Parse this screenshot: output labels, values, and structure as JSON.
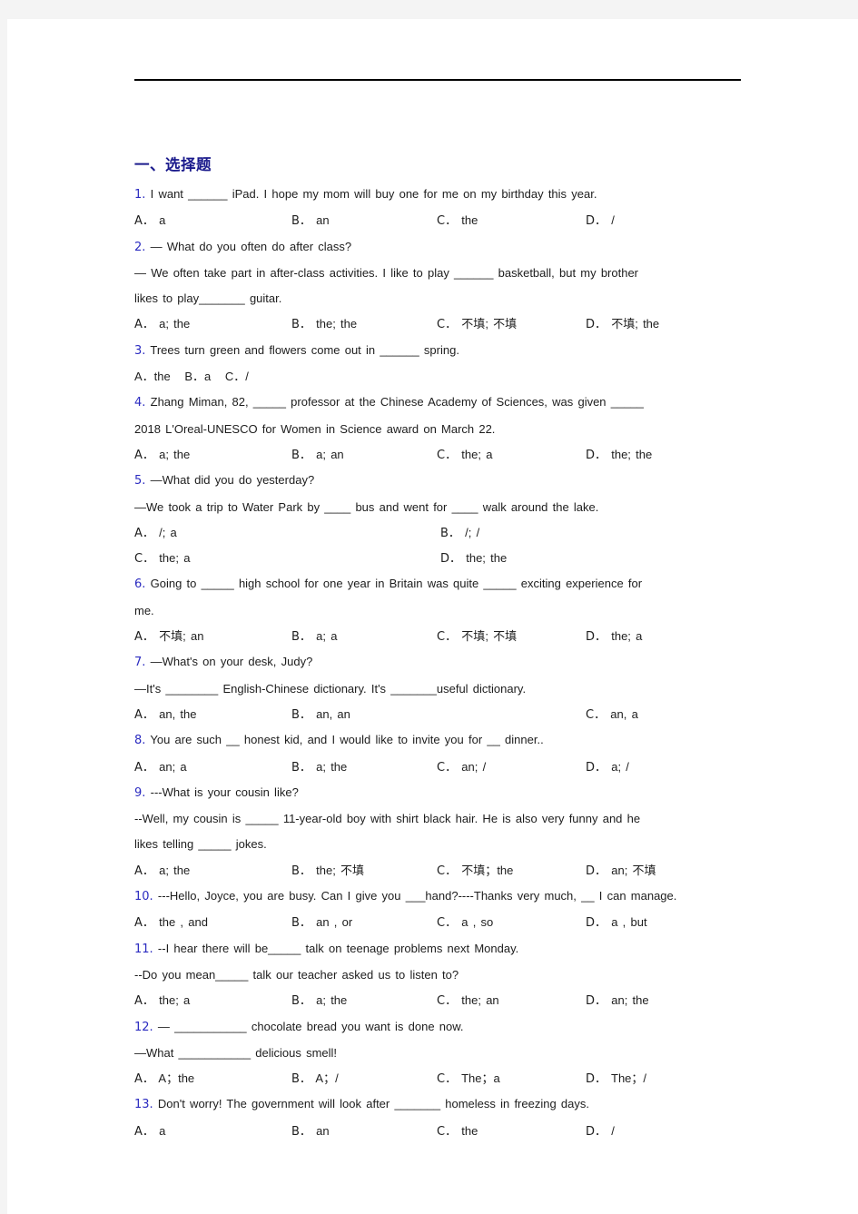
{
  "document": {
    "section_heading": "一、选择题",
    "questions": [
      {
        "number": "1.",
        "lines": [
          "I want ______ iPad. I hope my mom will buy one for me on my birthday this year."
        ],
        "option_layout": "four-col",
        "options": [
          {
            "letter": "A．",
            "text": "a"
          },
          {
            "letter": "B．",
            "text": "an"
          },
          {
            "letter": "C．",
            "text": "the"
          },
          {
            "letter": "D．",
            "text": "/"
          }
        ]
      },
      {
        "number": "2.",
        "lines": [
          "— What do you often do after class?",
          "— We often take part in after-class activities. I like to play ______ basketball, but my brother",
          "likes to play_______ guitar."
        ],
        "option_layout": "four-col",
        "options": [
          {
            "letter": "A．",
            "text": "a; the"
          },
          {
            "letter": "B．",
            "text": "the; the"
          },
          {
            "letter": "C．",
            "text": "不填; 不填"
          },
          {
            "letter": "D．",
            "text": "不填; the"
          }
        ]
      },
      {
        "number": "3.",
        "lines": [
          "Trees turn green and flowers come out in ______ spring."
        ],
        "option_layout": "inline",
        "options_inline": "A．the   B．a   C．/"
      },
      {
        "number": "4.",
        "lines": [
          "Zhang Miman, 82, _____ professor at the Chinese Academy of Sciences, was given _____",
          "2018 L'Oreal-UNESCO for Women in Science award on March 22."
        ],
        "option_layout": "four-col",
        "options": [
          {
            "letter": "A．",
            "text": "a; the"
          },
          {
            "letter": "B．",
            "text": "a; an"
          },
          {
            "letter": "C．",
            "text": "the; a"
          },
          {
            "letter": "D．",
            "text": "the; the"
          }
        ]
      },
      {
        "number": "5.",
        "lines": [
          "—What did you do yesterday?",
          "—We took a trip to Water Park by ____ bus and went for ____ walk around the lake."
        ],
        "option_layout": "two-col-two-row",
        "options": [
          {
            "letter": "A．",
            "text": "/; a"
          },
          {
            "letter": "B．",
            "text": "/; /"
          },
          {
            "letter": "C．",
            "text": "the; a"
          },
          {
            "letter": "D．",
            "text": "the; the"
          }
        ]
      },
      {
        "number": "6.",
        "lines": [
          "Going to _____ high school for one year in Britain was quite _____ exciting experience for",
          "me."
        ],
        "option_layout": "four-col",
        "options": [
          {
            "letter": "A．",
            "text": "不填; an"
          },
          {
            "letter": "B．",
            "text": "a; a"
          },
          {
            "letter": "C．",
            "text": "不填; 不填"
          },
          {
            "letter": "D．",
            "text": "the; a"
          }
        ]
      },
      {
        "number": "7.",
        "lines": [
          "—What's on your desk, Judy?",
          "—It's ________ English-Chinese dictionary. It's _______useful dictionary."
        ],
        "option_layout": "three-col",
        "options": [
          {
            "letter": "A．",
            "text": "an, the"
          },
          {
            "letter": "B．",
            "text": "an, an"
          },
          {
            "letter": "C．",
            "text": "an, a"
          }
        ]
      },
      {
        "number": "8.",
        "lines": [
          "You are such __ honest kid, and I would like to invite you for __ dinner.."
        ],
        "option_layout": "four-col",
        "options": [
          {
            "letter": "A．",
            "text": "an; a"
          },
          {
            "letter": "B．",
            "text": "a; the"
          },
          {
            "letter": "C．",
            "text": "an; /"
          },
          {
            "letter": "D．",
            "text": "a; /"
          }
        ]
      },
      {
        "number": "9.",
        "lines": [
          "---What is your cousin like?",
          "--Well, my cousin is _____ 11-year-old boy with shirt black hair. He is also very funny and he",
          "likes telling _____ jokes."
        ],
        "option_layout": "four-col",
        "options": [
          {
            "letter": "A．",
            "text": "a; the"
          },
          {
            "letter": "B．",
            "text": "the; 不填"
          },
          {
            "letter": "C．",
            "text": "不填；the"
          },
          {
            "letter": "D．",
            "text": "an; 不填"
          }
        ]
      },
      {
        "number": "10.",
        "lines": [
          "---Hello, Joyce, you are busy. Can I give you ___hand?----Thanks very much, __ I can manage."
        ],
        "option_layout": "four-col",
        "options": [
          {
            "letter": "A．",
            "text": "the , and"
          },
          {
            "letter": "B．",
            "text": "an , or"
          },
          {
            "letter": "C．",
            "text": "a , so"
          },
          {
            "letter": "D．",
            "text": "a , but"
          }
        ]
      },
      {
        "number": "11.",
        "lines": [
          "--I hear there will be_____ talk on teenage problems next Monday.",
          "--Do you mean_____ talk our teacher asked us to listen to?"
        ],
        "option_layout": "four-col",
        "options": [
          {
            "letter": "A．",
            "text": "the; a"
          },
          {
            "letter": "B．",
            "text": "a; the"
          },
          {
            "letter": "C．",
            "text": "the; an"
          },
          {
            "letter": "D．",
            "text": "an; the"
          }
        ]
      },
      {
        "number": "12.",
        "lines": [
          "— ___________ chocolate bread you want is done now.",
          "—What ___________ delicious smell!"
        ],
        "option_layout": "four-col",
        "options": [
          {
            "letter": "A．",
            "text": "A；the"
          },
          {
            "letter": "B．",
            "text": "A；/"
          },
          {
            "letter": "C．",
            "text": "The；a"
          },
          {
            "letter": "D．",
            "text": "The；/"
          }
        ]
      },
      {
        "number": "13.",
        "lines": [
          "Don't worry! The government will look after _______ homeless in freezing days."
        ],
        "option_layout": "four-col",
        "options": [
          {
            "letter": "A．",
            "text": "a"
          },
          {
            "letter": "B．",
            "text": "an"
          },
          {
            "letter": "C．",
            "text": "the"
          },
          {
            "letter": "D．",
            "text": "/"
          }
        ]
      }
    ]
  }
}
